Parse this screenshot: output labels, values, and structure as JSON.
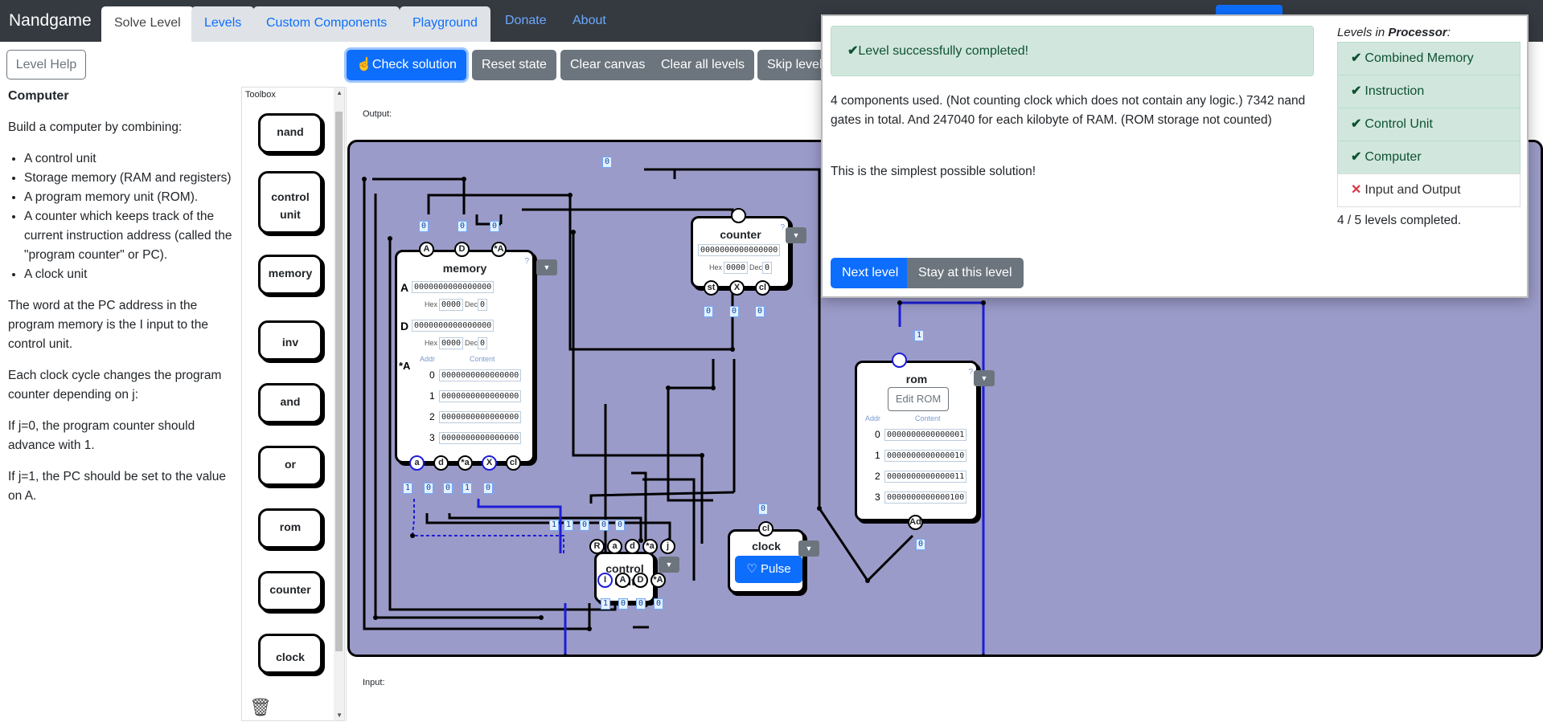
{
  "nav": {
    "brand": "Nandgame",
    "tabs": [
      "Solve Level",
      "Levels",
      "Custom Components",
      "Playground"
    ],
    "links": [
      "Donate",
      "About"
    ]
  },
  "left": {
    "level_help": "Level Help",
    "title": "Computer",
    "intro": "Build a computer by combining:",
    "bullets": [
      "A control unit",
      "Storage memory (RAM and registers)",
      "A program memory unit (ROM).",
      "A counter which keeps track of the current instruction address (called the \"program counter\" or PC).",
      "A clock unit"
    ],
    "p1": "The word at the PC address in the program memory is the I input to the control unit.",
    "p2": "Each clock cycle changes the program counter depending on j:",
    "p3": "If j=0, the program counter should advance with 1.",
    "p4": "If j=1, the PC should be set to the value on A."
  },
  "toolbar": {
    "check": "Check solution",
    "reset": "Reset state",
    "clear_canvas": "Clear canvas",
    "clear_all": "Clear all levels",
    "skip": "Skip level"
  },
  "toolbox": {
    "title": "Toolbox",
    "items": [
      "nand",
      "control unit",
      "memory",
      "inv",
      "and",
      "or",
      "rom",
      "counter",
      "clock"
    ]
  },
  "canvas": {
    "output_label": "Output:",
    "input_label": "Input:",
    "memory": {
      "name": "memory",
      "a_bits": "0000000000000000",
      "a_hex": "0000",
      "a_dec": "0",
      "d_bits": "0000000000000000",
      "d_hex": "0000",
      "d_dec": "0",
      "ram": [
        "0000000000000000",
        "0000000000000000",
        "0000000000000000",
        "0000000000000000"
      ]
    },
    "counter": {
      "name": "counter",
      "bits": "0000000000000000",
      "hex": "0000",
      "dec": "0"
    },
    "rom": {
      "name": "rom",
      "edit": "Edit ROM",
      "rows": [
        "0000000000000001",
        "0000000000000010",
        "0000000000000011",
        "0000000000000100"
      ]
    },
    "clock": {
      "name": "clock",
      "pulse": "Pulse"
    },
    "control_unit": {
      "name": "control unit"
    }
  },
  "popup": {
    "success": "Level successfully completed!",
    "stats": "4 components used. (Not counting clock which does not contain any logic.) 7342 nand gates in total. And 247040 for each kilobyte of RAM. (ROM storage not counted)",
    "simplest": "This is the simplest possible solution!",
    "next": "Next level",
    "stay": "Stay at this level",
    "levels_title_prefix": "Levels in ",
    "levels_title_group": "Processor",
    "levels_title_suffix": ":",
    "levels": [
      "Combined Memory",
      "Instruction",
      "Control Unit",
      "Computer",
      "Input and Output"
    ],
    "count": "4 / 5 levels completed."
  },
  "colors": {
    "primary": "#0d6efd",
    "success_bg": "#d1e7dd",
    "board": "#9b9bc9",
    "wire_active": "#1d1dd9"
  }
}
